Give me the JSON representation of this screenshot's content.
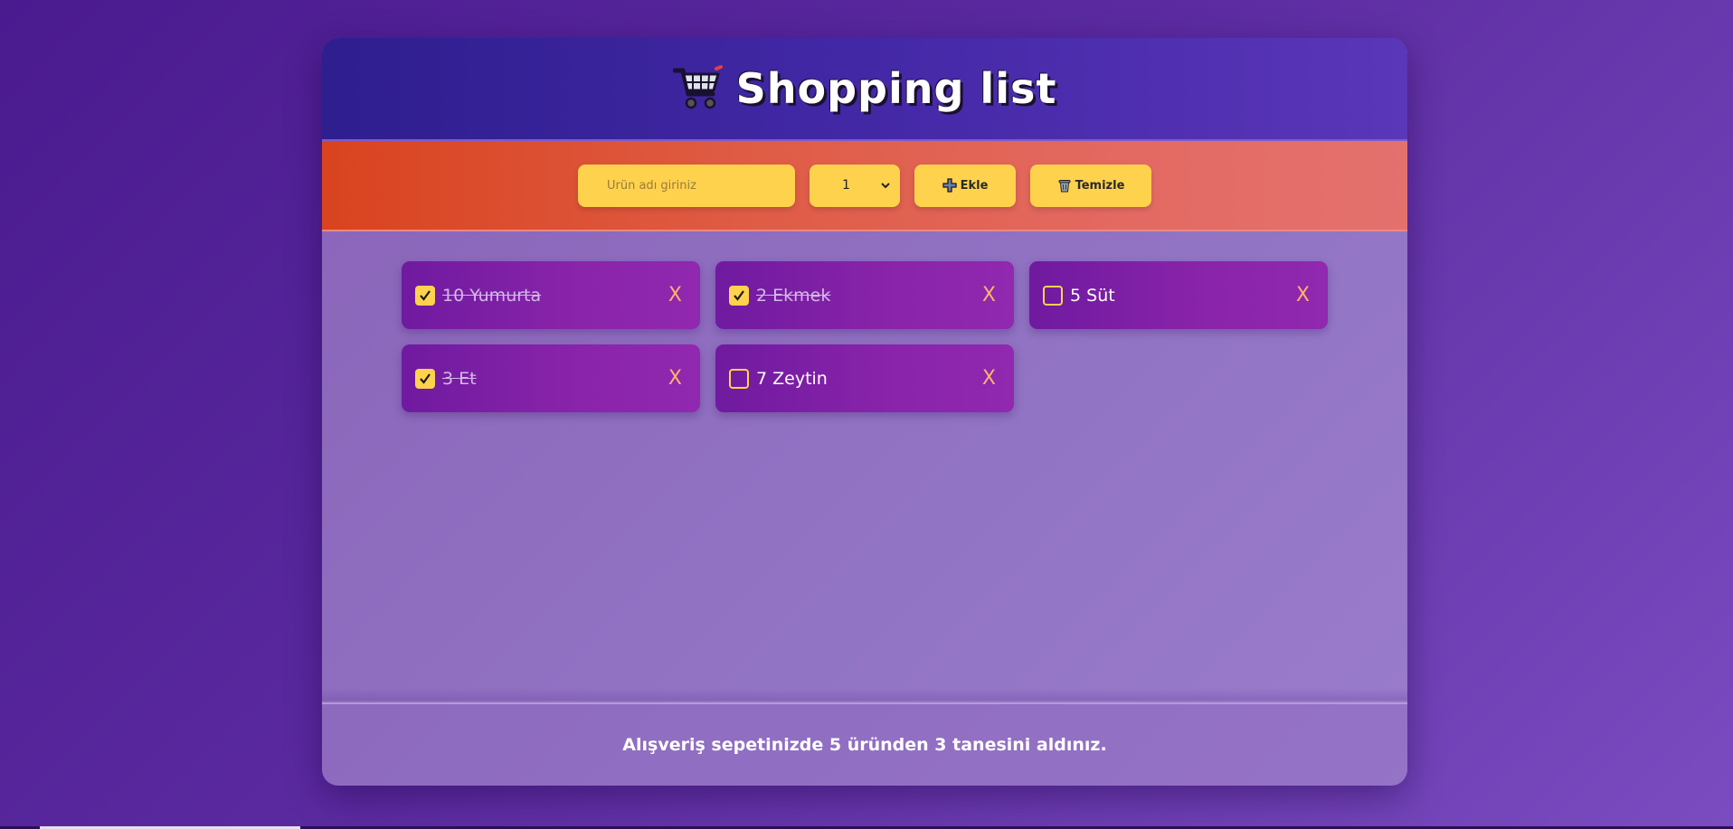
{
  "header": {
    "title": "Shopping list",
    "icon": "shopping-cart-icon"
  },
  "toolbar": {
    "product_placeholder": "Ürün adı giriniz",
    "quantity_value": "1",
    "add_label": "Ekle",
    "add_icon": "plus-icon",
    "clear_label": "Temizle",
    "clear_icon": "trash-icon"
  },
  "items": [
    {
      "label": "10 Yumurta",
      "checked": true,
      "delete_label": "X"
    },
    {
      "label": "2 Ekmek",
      "checked": true,
      "delete_label": "X"
    },
    {
      "label": "5 Süt",
      "checked": false,
      "delete_label": "X"
    },
    {
      "label": "3 Et",
      "checked": true,
      "delete_label": "X"
    },
    {
      "label": "7 Zeytin",
      "checked": false,
      "delete_label": "X"
    }
  ],
  "footer": {
    "summary": "Alışveriş sepetinizde 5 üründen 3 tanesini aldınız."
  },
  "colors": {
    "accent_yellow": "#ffd24d",
    "item_purple": "#8a24aa",
    "delete_orange": "#ffb36a"
  }
}
